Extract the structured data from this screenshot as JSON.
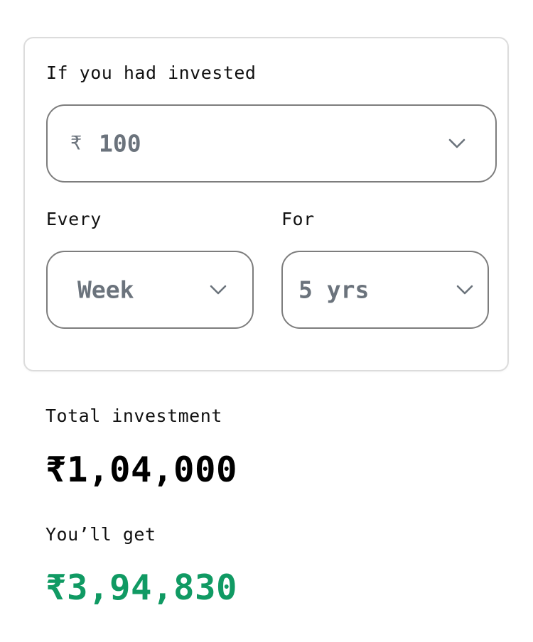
{
  "card": {
    "heading": "If you had invested",
    "amount_select": {
      "currency": "₹",
      "value": "100",
      "icon": "chevron-down-icon"
    },
    "frequency": {
      "label": "Every",
      "value": "Week",
      "icon": "chevron-down-icon"
    },
    "duration": {
      "label": "For",
      "value": "5 yrs",
      "icon": "chevron-down-icon"
    }
  },
  "results": {
    "total_label": "Total investment",
    "total_value": "₹1,04,000",
    "get_label": "You’ll get",
    "get_value": "₹3,94,830"
  },
  "colors": {
    "returns_green": "#109a63",
    "field_text": "#6b737c",
    "field_border": "#7d7d7d",
    "card_border": "#dcdcdc"
  }
}
